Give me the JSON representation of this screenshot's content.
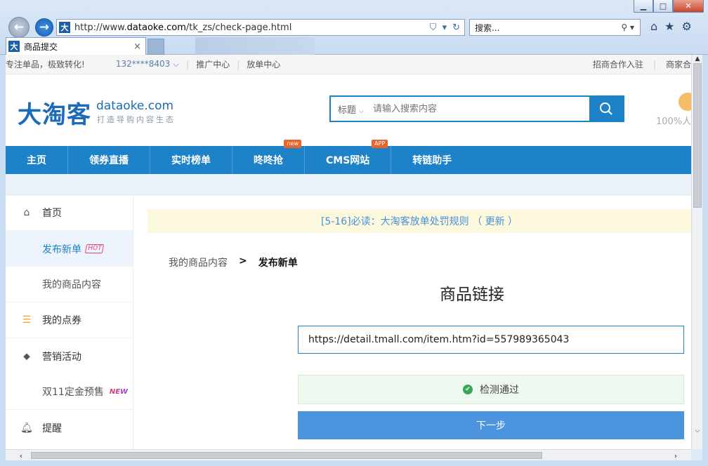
{
  "browser": {
    "url_prefix": "http://www.",
    "url_domain": "dataoke.com",
    "url_path": "/tk_zs/check-page.html",
    "favicon_char": "大",
    "search_placeholder": "搜索...",
    "tab_title": "商品提交",
    "tab_close": "×"
  },
  "topbar": {
    "slogan": "专注单品，极致转化!",
    "phone": "132****8403 ⌵",
    "links": [
      "推广中心",
      "放单中心"
    ],
    "right_links": [
      "招商合作入驻",
      "商家合"
    ]
  },
  "header": {
    "logo_cn": "大淘客",
    "logo_en": "dataoke.com",
    "logo_sub": "打造导购内容生态",
    "search_category": "标题",
    "search_placeholder": "请输入搜索内容",
    "percent_text": "100%人"
  },
  "nav": {
    "items": [
      {
        "label": "主页",
        "badge": ""
      },
      {
        "label": "领券直播",
        "badge": ""
      },
      {
        "label": "实时榜单",
        "badge": ""
      },
      {
        "label": "咚咚抢",
        "badge": "new"
      },
      {
        "label": "CMS网站",
        "badge": "APP"
      },
      {
        "label": "转链助手",
        "badge": ""
      }
    ]
  },
  "sidebar": {
    "items": [
      {
        "label": "首页",
        "icon": "home-icon"
      },
      {
        "label": "发布新单",
        "tag": "HOT"
      },
      {
        "label": "我的商品内容"
      },
      {
        "label": "我的点券",
        "icon": "coins-icon"
      },
      {
        "label": "营销活动",
        "icon": "tag-icon"
      },
      {
        "label": "双11定金预售",
        "tag": "NEW"
      },
      {
        "label": "提醒",
        "icon": "bell-icon"
      }
    ]
  },
  "main": {
    "notice": "[5-16]必读：大淘客放单处罚规则 （ 更新 ）",
    "breadcrumb": [
      "我的商品内容",
      ">",
      "发布新单"
    ],
    "heading": "商品链接",
    "link_value": "https://detail.tmall.com/item.htm?id=557989365043",
    "check_text": "检测通过",
    "next_label": "下一步"
  },
  "colors": {
    "brand_blue": "#1d82c8",
    "notice_bg": "#fbf8dd",
    "success_green": "#35a853",
    "button_blue": "#4d94de"
  }
}
